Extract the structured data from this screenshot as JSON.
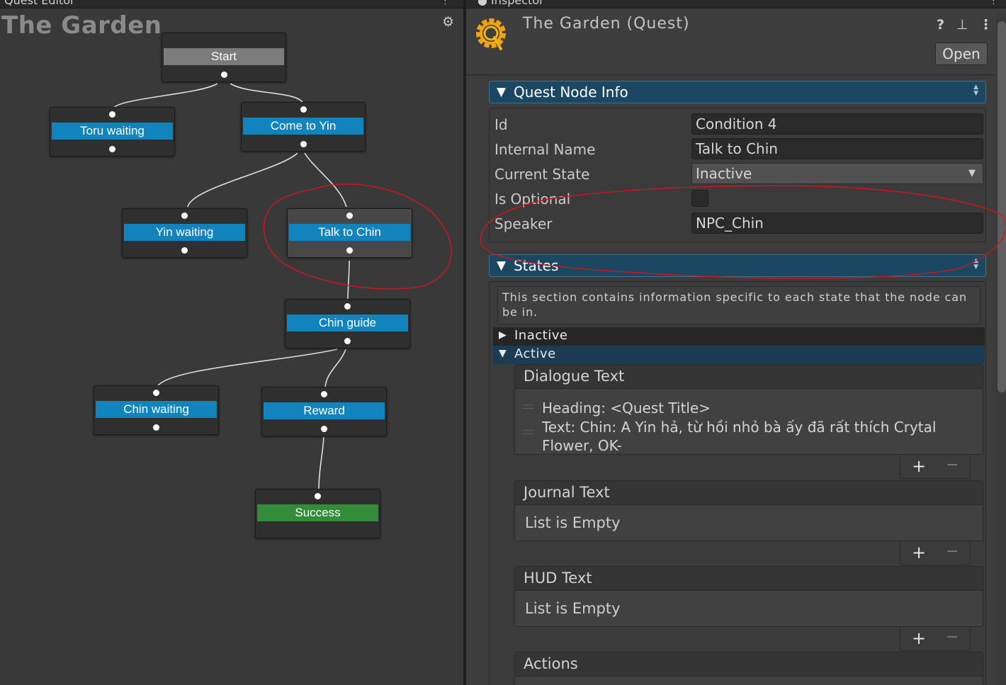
{
  "quest_editor": {
    "window_tab": "Quest Editor",
    "graph_title": "The Garden",
    "nodes": {
      "start": "Start",
      "toru_waiting": "Toru waiting",
      "come_to_yin": "Come to Yin",
      "yin_waiting": "Yin waiting",
      "talk_to_chin": "Talk to Chin",
      "chin_guide": "Chin guide",
      "chin_waiting": "Chin waiting",
      "reward": "Reward",
      "success": "Success"
    }
  },
  "inspector": {
    "window_tab": "Inspector",
    "asset_title": "The Garden (Quest)",
    "open_label": "Open",
    "quest_node_info": {
      "section_label": "Quest Node Info",
      "id_label": "Id",
      "id_value": "Condition 4",
      "internal_name_label": "Internal Name",
      "internal_name_value": "Talk to Chin",
      "current_state_label": "Current State",
      "current_state_value": "Inactive",
      "is_optional_label": "Is Optional",
      "is_optional_checked": false,
      "speaker_label": "Speaker",
      "speaker_value": "NPC_Chin"
    },
    "states": {
      "section_label": "States",
      "help_text": "This section contains information specific to each state that the node can be in.",
      "inactive_label": "Inactive",
      "active_label": "Active",
      "dialogue_text": {
        "header": "Dialogue Text",
        "entry_1": "Heading: <Quest Title>",
        "entry_2": "Text:  Chin: A Yin hả, từ hồi nhỏ bà ấy đã rất thích Crytal Flower, OK-"
      },
      "journal_text": {
        "header": "Journal Text",
        "empty": "List is Empty"
      },
      "hud_text": {
        "header": "HUD Text",
        "empty": "List is Empty"
      },
      "actions": {
        "header": "Actions"
      }
    }
  },
  "colors": {
    "node_label_blue": "#1184be",
    "node_label_grey": "#7b7b7b",
    "node_label_green": "#338c39",
    "section_header": "#1b4763",
    "annotation_red": "#d3141c"
  }
}
